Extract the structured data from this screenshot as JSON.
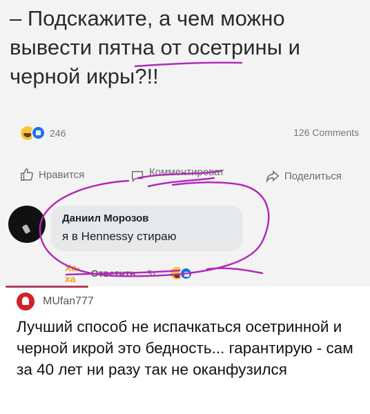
{
  "post": {
    "text": "– Подскажите, а чем можно вывести пятна от осетрины и черной икры?!!",
    "reactions_count": "246",
    "comments_count": "126 Comments"
  },
  "actions": {
    "like_label": "Нравится",
    "comment_label": "Комментироват",
    "share_label": "Поделиться"
  },
  "comment": {
    "author": "Даниил Морозов",
    "text": "я в Hennessy стираю",
    "reaction_label": "Ха-ха",
    "reply_label": "Ответить",
    "time": "3т"
  },
  "response": {
    "username": "MUfan777",
    "text": "Лучший способ не испачкаться осетринной и черной икрой это бедность... гарантирую - сам за 40 лет ни разу так не оканфузился"
  },
  "colors": {
    "annotation": "#b02ab8",
    "like_blue": "#1b74e4",
    "haha_yellow": "#f7c53b"
  },
  "icons": {
    "like": "thumbs-up-icon",
    "comment": "comment-bubble-icon",
    "share": "share-arrow-icon"
  }
}
